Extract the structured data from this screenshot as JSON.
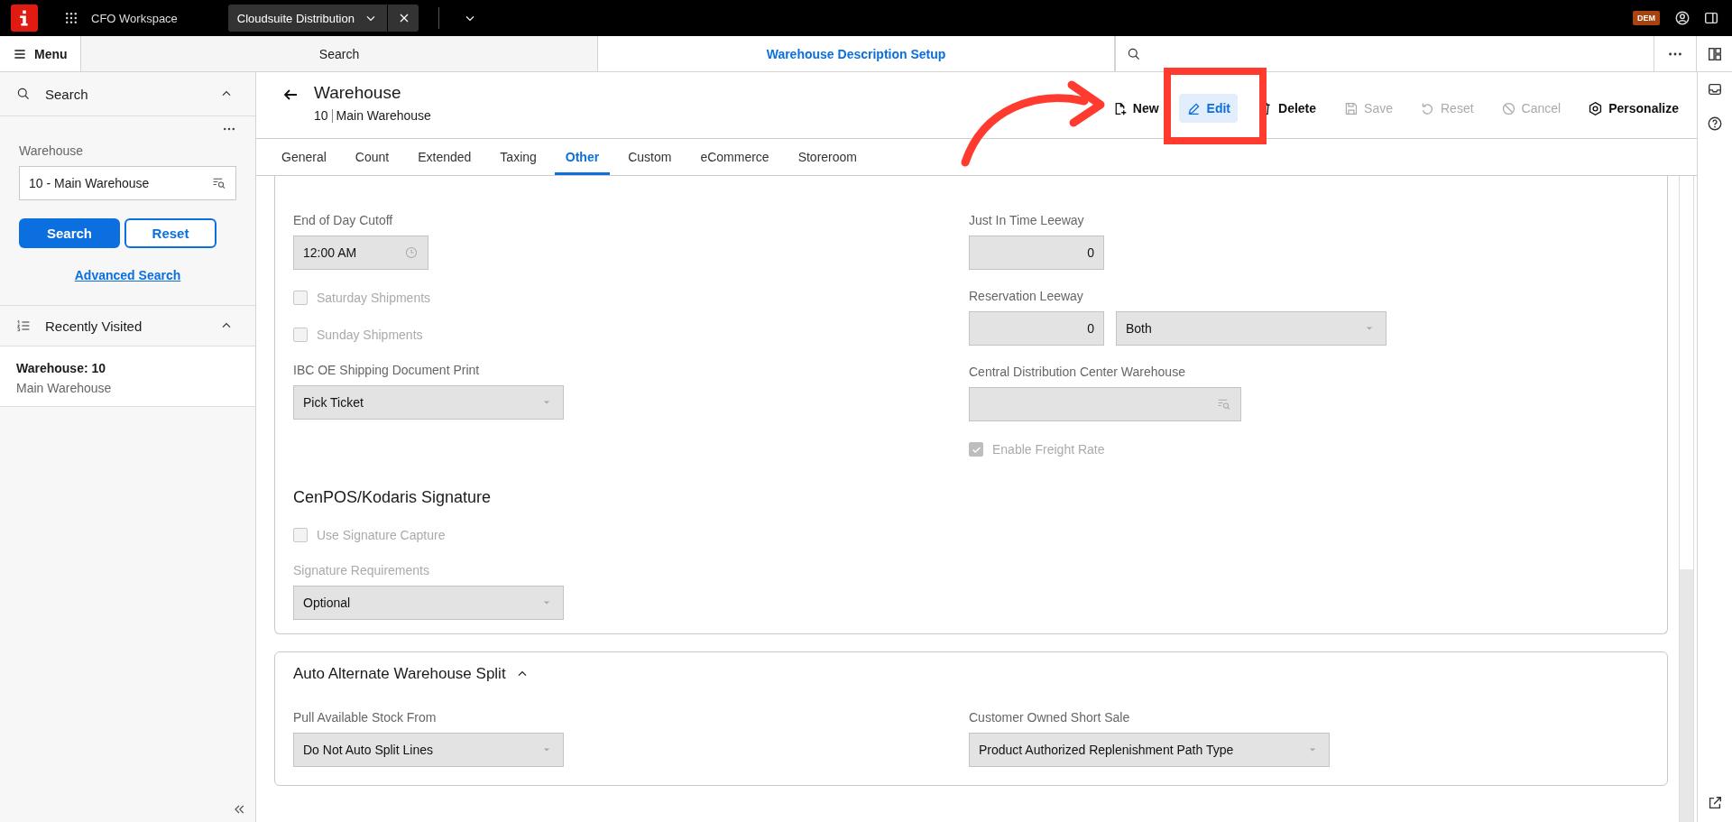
{
  "app_bar": {
    "workspace": "CFO Workspace",
    "open_tab": "Cloudsuite Distribution",
    "user_badge": "DEM"
  },
  "nav_bar": {
    "menu": "Menu",
    "tabs": [
      {
        "label": "Search",
        "selected": false
      },
      {
        "label": "Warehouse Description Setup",
        "selected": true
      }
    ]
  },
  "sidebar": {
    "search_panel": {
      "title": "Search",
      "expanded": true,
      "field_label": "Warehouse",
      "field_value": "10 - Main Warehouse",
      "buttons": [
        {
          "label": "Search",
          "kind": "primary"
        },
        {
          "label": "Reset",
          "kind": "secondary"
        }
      ],
      "link": "Advanced Search"
    },
    "recent": {
      "title": "Recently Visited",
      "expanded": true,
      "items": [
        {
          "title": "Warehouse: 10",
          "subtitle": "Main Warehouse"
        }
      ]
    }
  },
  "header": {
    "title": "Warehouse",
    "id": "10",
    "name": "Main Warehouse",
    "actions": [
      {
        "label": "New",
        "disabled": false,
        "selected": false
      },
      {
        "label": "Edit",
        "disabled": false,
        "selected": true
      },
      {
        "label": "Delete",
        "disabled": false,
        "selected": false
      },
      {
        "label": "Save",
        "disabled": true,
        "selected": false
      },
      {
        "label": "Reset",
        "disabled": true,
        "selected": false
      },
      {
        "label": "Cancel",
        "disabled": true,
        "selected": false
      },
      {
        "label": "Personalize",
        "disabled": false,
        "selected": false
      }
    ]
  },
  "tabs": [
    {
      "label": "General",
      "selected": false
    },
    {
      "label": "Count",
      "selected": false
    },
    {
      "label": "Extended",
      "selected": false
    },
    {
      "label": "Taxing",
      "selected": false
    },
    {
      "label": "Other",
      "selected": true
    },
    {
      "label": "Custom",
      "selected": false
    },
    {
      "label": "eCommerce",
      "selected": false
    },
    {
      "label": "Storeroom",
      "selected": false
    }
  ],
  "sections": [
    {
      "columns": [
        [
          {
            "kind": "time",
            "label": "End of Day Cutoff",
            "value": "12:00 AM",
            "disabled": false
          },
          {
            "kind": "check",
            "label": "Saturday Shipments",
            "checked": false,
            "disabled": true
          },
          {
            "kind": "check",
            "label": "Sunday Shipments",
            "checked": false,
            "disabled": true
          },
          {
            "kind": "select",
            "label": "IBC OE Shipping Document Print",
            "value": "Pick Ticket",
            "disabled": false
          },
          {
            "kind": "heading",
            "label": "CenPOS/Kodaris Signature"
          },
          {
            "kind": "check",
            "label": "Use Signature Capture",
            "checked": false,
            "disabled": true
          },
          {
            "kind": "select",
            "label": "Signature Requirements",
            "value": "Optional",
            "disabled": true
          }
        ],
        [
          {
            "kind": "number",
            "label": "Just In Time Leeway",
            "value": "0",
            "disabled": false
          },
          {
            "kind": "number_select",
            "label": "Reservation Leeway",
            "value": "0",
            "option": "Both",
            "disabled": false
          },
          {
            "kind": "lookup",
            "label": "Central Distribution Center Warehouse",
            "disabled": false
          },
          {
            "kind": "check",
            "label": "Enable Freight Rate",
            "checked": true,
            "disabled": true
          }
        ]
      ]
    },
    {
      "title": "Auto Alternate Warehouse Split",
      "expanded": true,
      "columns": [
        [
          {
            "kind": "select",
            "label": "Pull Available Stock From",
            "value": "Do Not Auto Split Lines",
            "disabled": false
          }
        ],
        [
          {
            "kind": "select",
            "label": "Customer Owned Short Sale",
            "value": "Product Authorized Replenishment Path Type",
            "disabled": false
          }
        ]
      ]
    }
  ],
  "annotation": {
    "visible": true
  }
}
